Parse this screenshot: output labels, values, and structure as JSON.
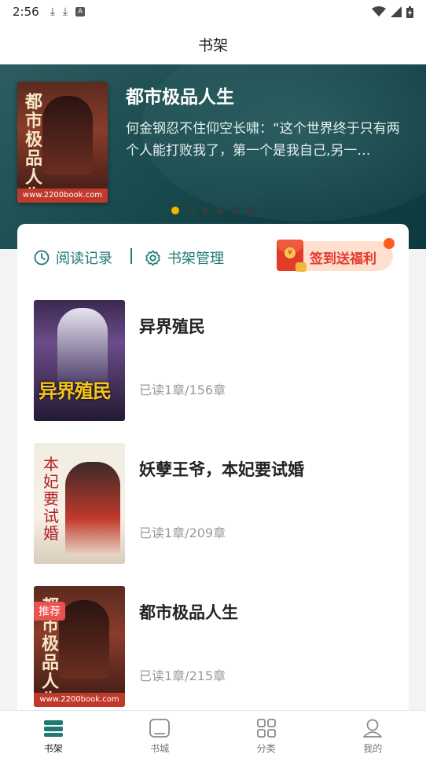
{
  "status_bar": {
    "time": "2:56"
  },
  "title": "书架",
  "banner": {
    "book_title": "都市极品人生",
    "description": "何金钢忍不住仰空长啸：“这个世界终于只有两个人能打败我了，第一个是我自己,另一…",
    "dots_count": 6,
    "active_dot": 0,
    "cover_text": "都市极品人生",
    "cover_footer": "www.2200book.com"
  },
  "actions": {
    "history_label": "阅读记录",
    "manage_label": "书架管理",
    "signin_label": "签到送福利"
  },
  "books": [
    {
      "title": "异界殖民",
      "progress": "已读1章/156章",
      "cover_text": "异界殖民",
      "recommend": ""
    },
    {
      "title": "妖孽王爷，本妃要试婚",
      "progress": "已读1章/209章",
      "cover_text": "本妃要试婚",
      "recommend": ""
    },
    {
      "title": "都市极品人生",
      "progress": "已读1章/215章",
      "cover_text": "都市极品人生",
      "recommend": "推荐",
      "cover_footer": "www.2200book.com"
    }
  ],
  "nav": [
    {
      "label": "书架",
      "icon": "bookshelf-icon",
      "active": true
    },
    {
      "label": "书城",
      "icon": "bookstore-icon",
      "active": false
    },
    {
      "label": "分类",
      "icon": "category-grid-icon",
      "active": false
    },
    {
      "label": "我的",
      "icon": "profile-icon",
      "active": false
    }
  ],
  "colors": {
    "accent": "#1e7a72",
    "banner_bg": "#1d4e51",
    "active_dot": "#f2b500",
    "signin_text": "#e33a2f"
  }
}
